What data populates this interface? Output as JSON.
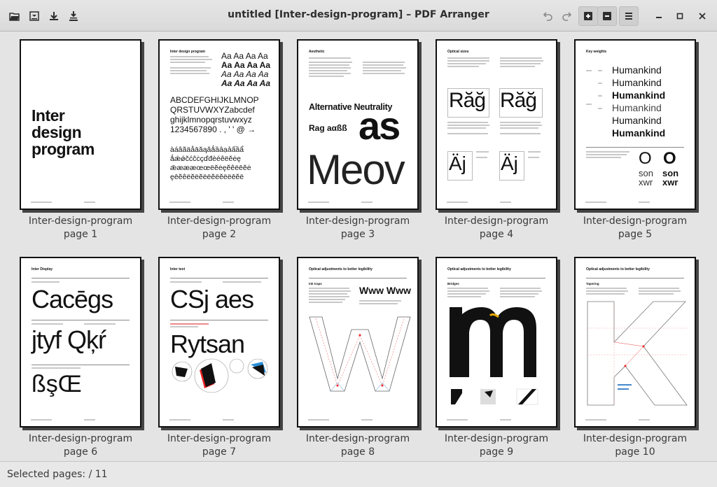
{
  "window": {
    "title": "untitled [Inter-design-program] – PDF Arranger"
  },
  "toolbar": {
    "left": [
      "open-icon",
      "save-icon",
      "export-icon",
      "export-selection-icon"
    ],
    "right": [
      "undo-icon",
      "redo-icon",
      "zoom-in-icon",
      "zoom-out-icon",
      "menu-icon"
    ],
    "window_controls": [
      "minimize-icon",
      "maximize-icon",
      "close-icon"
    ]
  },
  "pages": [
    {
      "name": "Inter-design-program",
      "caption": "page 1"
    },
    {
      "name": "Inter-design-program",
      "caption": "page 2"
    },
    {
      "name": "Inter-design-program",
      "caption": "page 3"
    },
    {
      "name": "Inter-design-program",
      "caption": "page 4"
    },
    {
      "name": "Inter-design-program",
      "caption": "page 5"
    },
    {
      "name": "Inter-design-program",
      "caption": "page 6"
    },
    {
      "name": "Inter-design-program",
      "caption": "page 7"
    },
    {
      "name": "Inter-design-program",
      "caption": "page 8"
    },
    {
      "name": "Inter-design-program",
      "caption": "page 9"
    },
    {
      "name": "Inter-design-program",
      "caption": "page 10"
    }
  ],
  "thumbs": {
    "p1": {
      "title": "Inter\ndesign\nprogram"
    },
    "p2": {
      "heading": "Inter design program",
      "alphabet": "ABCDEFGHIJKLMNOP\nQRSTUVWXYZabcdef\nghijklmnopqrstuvwxyz\n1234567890 . , ' ' @ →",
      "weights": "Aa Aa Aa Aa",
      "accents": "àáâãäåāăąǎǻȁȃạảấầẩ\nǻǽǿčćĉċçďđèéêëěėę\nǣæææœœëĕėęĕêëēĕė\nęēĕêëĕëĕëëĕëĕëëēĕë"
    },
    "p3": {
      "heading": "Aesthetic",
      "tagline": "Alternative Neutrality",
      "sample": "Rag aαßß",
      "big": "as",
      "light": "Meov"
    },
    "p4": {
      "heading": "Optical sizes",
      "glyph_a": "Răğ",
      "glyph_b": "Răğ",
      "glyph_c": "Äj",
      "glyph_d": "Äj"
    },
    "p5": {
      "heading": "Key weights",
      "word": "Humankind",
      "o_pair": "O O",
      "son": "son",
      "xwr": "xwr"
    },
    "p6": {
      "heading": "Inter Display",
      "line1": "Cacēgs",
      "line2": "jtyf Qķŕ",
      "line3": "ßşŒ"
    },
    "p7": {
      "heading": "Inter text",
      "line1": "CSj aes",
      "line2": "Rytsan"
    },
    "p8": {
      "heading": "Optical adjustments to better legibility",
      "sub": "Ink traps",
      "sample": "Www Www"
    },
    "p9": {
      "heading": "Optical adjustments to better legibility",
      "sub": "Bridges"
    },
    "p10": {
      "heading": "Optical adjustments to better legibility",
      "sub": "Tapering"
    }
  },
  "status": {
    "label": "Selected pages:",
    "value": " / 11"
  }
}
